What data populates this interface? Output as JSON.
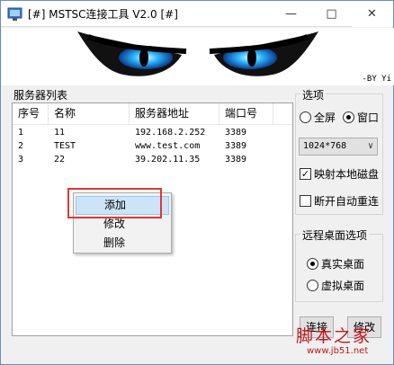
{
  "window": {
    "title": "[#] MSTSC连接工具 V2.0 [#]",
    "controls": {
      "minimize": "—",
      "maximize": "□",
      "close": "✕"
    }
  },
  "banner": {
    "credit": "-BY Yi"
  },
  "server_list": {
    "title": "服务器列表",
    "columns": [
      "序号",
      "名称",
      "服务器地址",
      "端口号"
    ],
    "rows": [
      [
        "1",
        "11",
        "192.168.2.252",
        "3389"
      ],
      [
        "2",
        "TEST",
        "www.test.com",
        "3389"
      ],
      [
        "3",
        "22",
        "39.202.11.35",
        "3389"
      ]
    ]
  },
  "context_menu": {
    "items": [
      "添加",
      "修改",
      "删除"
    ],
    "highlighted": "添加"
  },
  "options": {
    "title": "选项",
    "fullscreen_label": "全屏",
    "window_label": "窗口",
    "window_selected": true,
    "resolution": "1024*768",
    "map_disk_label": "映射本地磁盘",
    "map_disk_checked": true,
    "auto_reconnect_label": "断开自动重连",
    "auto_reconnect_checked": false
  },
  "remote_options": {
    "title": "远程桌面选项",
    "real_desktop_label": "真实桌面",
    "virtual_desktop_label": "虚拟桌面",
    "real_selected": true
  },
  "buttons": {
    "connect": "连接",
    "edit": "修改"
  },
  "watermark": {
    "chinese": "脚本之家",
    "url": "www.jb51.net"
  },
  "colors": {
    "highlight": "#cce4f7",
    "annotation": "#e0392f",
    "watermark": "#c0191e",
    "eyes": "#19a7f0"
  }
}
